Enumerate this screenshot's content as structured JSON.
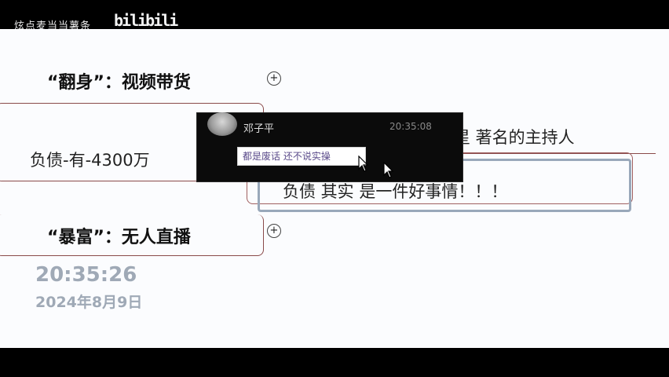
{
  "top_bar": {
    "watermark": "炫点麦当当薯条",
    "logo": "bilibili"
  },
  "slide": {
    "heading_1": "“翻身”：视频带货",
    "heading_2": "“暴富”：无人直播",
    "box1_text": "负债-有-4300万",
    "right_top_text": "星  著名的主持人",
    "box3_text": "负债 其实 是一件好事情！！！",
    "plus_symbol": "+"
  },
  "clock": {
    "time": "20:35:26",
    "date": "2024年8月9日"
  },
  "notification": {
    "sender": "邓子平",
    "timestamp": "20:35:08",
    "message": "都是废话 还不说实操"
  }
}
